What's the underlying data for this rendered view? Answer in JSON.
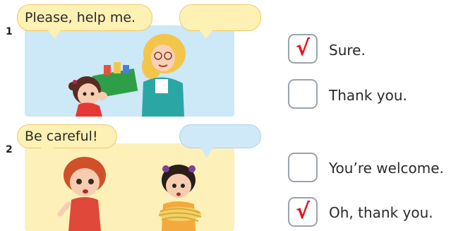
{
  "items": [
    {
      "number": "1",
      "speech_left": "Please, help me.",
      "speech_right": "",
      "options": [
        {
          "label": "Sure.",
          "checked": true
        },
        {
          "label": "Thank you.",
          "checked": false
        }
      ]
    },
    {
      "number": "2",
      "speech_left": "Be careful!",
      "speech_right": "",
      "options": [
        {
          "label": "You’re welcome.",
          "checked": false
        },
        {
          "label": "Oh, thank you.",
          "checked": true
        }
      ]
    }
  ],
  "check_mark": "√",
  "colors": {
    "panel1_bg": "#cde8f7",
    "panel2_bg": "#fdf0b8",
    "check_red": "#e0161b",
    "bubble_yellow": "#fdf1b4",
    "bubble_blue": "#cfe9f8"
  }
}
